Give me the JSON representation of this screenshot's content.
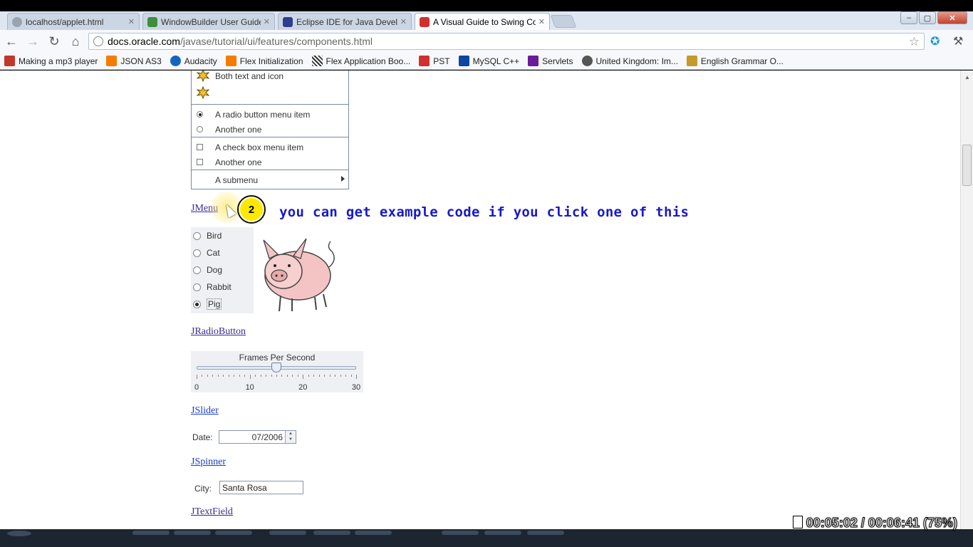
{
  "tabs": [
    {
      "title": "localhost/applet.html",
      "color": "#9aa4b0",
      "active": false
    },
    {
      "title": "WindowBuilder User Guide",
      "color": "#3d8f3d",
      "active": false
    },
    {
      "title": "Eclipse IDE for Java Develo",
      "color": "#2b3f8c",
      "active": false
    },
    {
      "title": "A Visual Guide to Swing Co",
      "color": "#d32f2f",
      "active": true
    }
  ],
  "omnibox": {
    "host": "docs.oracle.com",
    "path": "/javase/tutorial/ui/features/components.html"
  },
  "bookmarks": [
    {
      "label": "Making a mp3 player",
      "color": "#c0392b"
    },
    {
      "label": "JSON AS3",
      "color": "#f57c00"
    },
    {
      "label": "Audacity",
      "color": "#1565c0"
    },
    {
      "label": "Flex Initialization",
      "color": "#f57c00"
    },
    {
      "label": "Flex Application Boo...",
      "color": "#333333"
    },
    {
      "label": "PST",
      "color": "#d32f2f"
    },
    {
      "label": "MySQL C++",
      "color": "#0d47a1"
    },
    {
      "label": "Servlets",
      "color": "#6a1b9a"
    },
    {
      "label": "United Kingdom: Im...",
      "color": "#555555"
    },
    {
      "label": "English Grammar O...",
      "color": "#c49a2a"
    }
  ],
  "menu_demo": {
    "both_text_icon": "Both text and icon",
    "radio_item": "A radio button menu item",
    "radio_another": "Another one",
    "check_item": "A check box menu item",
    "check_another": "Another one",
    "submenu": "A submenu"
  },
  "links": {
    "jmenu": "JMenu",
    "jradiobutton": "JRadioButton",
    "jslider": "JSlider",
    "jspinner": "JSpinner",
    "jtextfield": "JTextField"
  },
  "annotation": {
    "step": "2",
    "caption": "you can get example code if you click one of this"
  },
  "radio_demo": {
    "options": [
      "Bird",
      "Cat",
      "Dog",
      "Rabbit",
      "Pig"
    ],
    "selected": "Pig"
  },
  "slider_demo": {
    "title": "Frames Per Second",
    "min": 0,
    "max": 30,
    "value": 15,
    "labels": [
      "0",
      "10",
      "20",
      "30"
    ]
  },
  "spinner_demo": {
    "label": "Date:",
    "value": "07/2006"
  },
  "textfield_demo": {
    "label": "City:",
    "value": "Santa Rosa"
  },
  "player": {
    "elapsed": "00:05:02",
    "separator": "/",
    "total": "00:06:41",
    "zoom": "(75%)"
  }
}
